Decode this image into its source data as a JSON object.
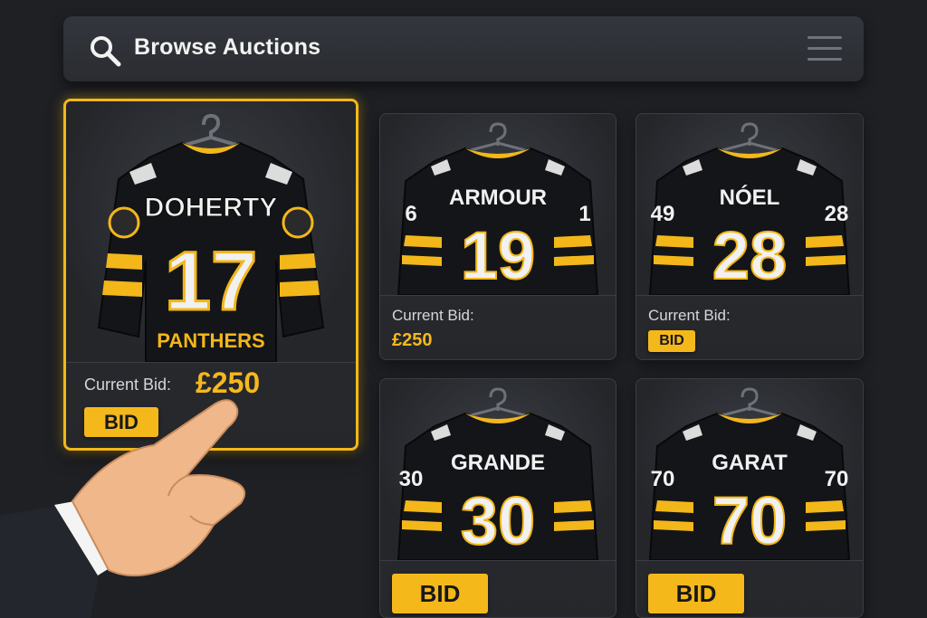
{
  "header": {
    "title": "Browse Auctions",
    "search_icon": "search-icon",
    "menu_icon": "hamburger-menu-icon"
  },
  "colors": {
    "background": "#1e2024",
    "accent": "#f5b81b",
    "jersey_black": "#141518",
    "jersey_gold": "#f3b71a",
    "number_white": "#f1f1f1"
  },
  "featured": {
    "name": "DOHERTY",
    "number": "17",
    "team": "PANTHERS",
    "bid_label": "Current Bid:",
    "bid_amount": "£250",
    "bid_button": "BID",
    "selected": true
  },
  "auctions": [
    {
      "name": "ARMOUR",
      "number": "19",
      "sleeve_left": "6",
      "sleeve_right": "1",
      "bid_label": "Current Bid:",
      "bid_amount": "£250"
    },
    {
      "name": "NÓEL",
      "number": "28",
      "sleeve_left": "49",
      "sleeve_right": "28",
      "bid_label": "Current Bid:",
      "bid_button": "BID"
    },
    {
      "name": "GRANDE",
      "number": "30",
      "sleeve_left": "30",
      "sleeve_right": "",
      "bid_button": "BID"
    },
    {
      "name": "GARAT",
      "number": "70",
      "sleeve_left": "70",
      "sleeve_right": "70",
      "bid_button": "BID"
    }
  ],
  "pointer": "pointing-hand-icon"
}
